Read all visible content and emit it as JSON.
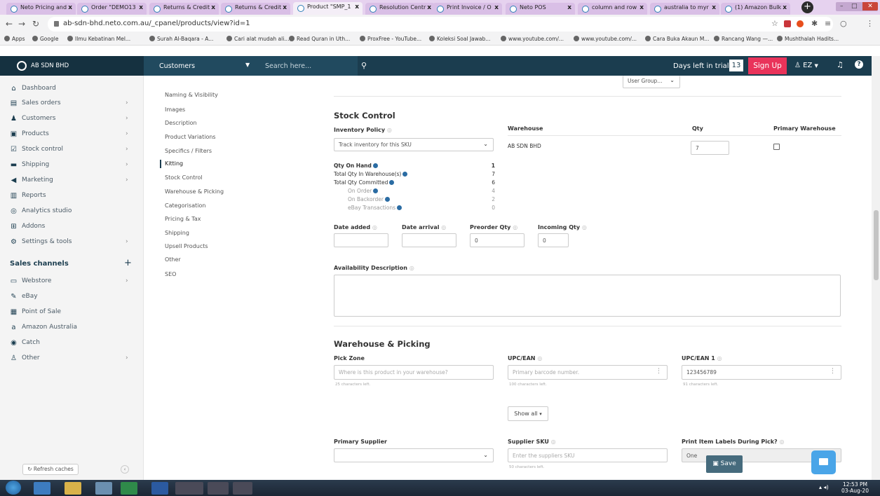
{
  "browser": {
    "tabs": [
      {
        "label": "Neto Pricing and"
      },
      {
        "label": "Order \"DEMO13"
      },
      {
        "label": "Returns & Credit"
      },
      {
        "label": "Returns & Credit"
      },
      {
        "label": "Product \"SMP_1"
      },
      {
        "label": "Resolution Centr"
      },
      {
        "label": "Print Invoice / O"
      },
      {
        "label": "Neto POS"
      },
      {
        "label": "column and row"
      },
      {
        "label": "australia to myr"
      },
      {
        "label": "(1) Amazon Bulk"
      }
    ],
    "active_tab_index": 4,
    "url": "ab-sdn-bhd.neto.com.au/_cpanel/products/view?id=1",
    "bookmarks": [
      "Apps",
      "Google",
      "Ilmu Kebatinan Mel...",
      "Surah Al-Baqara - A...",
      "Cari alat mudah ali...",
      "Read Quran in Uth...",
      "ProxFree - YouTube...",
      "Koleksi Soal Jawab...",
      "www.youtube.com/...",
      "www.youtube.com/...",
      "Cara Buka Akaun M...",
      "Rancang Wang —...",
      "Mushthalah Hadits..."
    ]
  },
  "header": {
    "company": "AB SDN BHD",
    "context_select": "Customers",
    "search_placeholder": "Search here...",
    "trial_label": "Days left in trial",
    "trial_days": "13",
    "signup": "Sign Up",
    "user": "EZ"
  },
  "sidebar": {
    "items": [
      {
        "label": "Dashboard",
        "icon": "home-icon",
        "glyph": "⌂"
      },
      {
        "label": "Sales orders",
        "icon": "document-icon",
        "glyph": "▤"
      },
      {
        "label": "Customers",
        "icon": "users-icon",
        "glyph": "♟"
      },
      {
        "label": "Products",
        "icon": "box-icon",
        "glyph": "▣"
      },
      {
        "label": "Stock control",
        "icon": "check-icon",
        "glyph": "☑"
      },
      {
        "label": "Shipping",
        "icon": "truck-icon",
        "glyph": "▬"
      },
      {
        "label": "Marketing",
        "icon": "megaphone-icon",
        "glyph": "◀"
      },
      {
        "label": "Reports",
        "icon": "bar-chart-icon",
        "glyph": "▥"
      },
      {
        "label": "Analytics studio",
        "icon": "analytics-icon",
        "glyph": "◎"
      },
      {
        "label": "Addons",
        "icon": "plus-box-icon",
        "glyph": "⊞"
      },
      {
        "label": "Settings & tools",
        "icon": "gear-icon",
        "glyph": "⚙"
      }
    ],
    "channels_heading": "Sales channels",
    "channels": [
      {
        "label": "Webstore",
        "icon": "webstore-icon",
        "glyph": "▭"
      },
      {
        "label": "eBay",
        "icon": "ebay-icon",
        "glyph": "✎"
      },
      {
        "label": "Point of Sale",
        "icon": "pos-icon",
        "glyph": "▦"
      },
      {
        "label": "Amazon Australia",
        "icon": "amazon-icon",
        "glyph": "a"
      },
      {
        "label": "Catch",
        "icon": "catch-icon",
        "glyph": "◉"
      },
      {
        "label": "Other",
        "icon": "other-icon",
        "glyph": "♙"
      }
    ],
    "refresh": "Refresh caches"
  },
  "section_nav": [
    "Naming & Visibility",
    "Images",
    "Description",
    "Product Variations",
    "Specifics / Filters",
    "Kitting",
    "Stock Control",
    "Warehouse & Picking",
    "Categorisation",
    "Pricing & Tax",
    "Shipping",
    "Upsell Products",
    "Other",
    "SEO"
  ],
  "main": {
    "user_group_select": "User Group...",
    "stock_control": {
      "title": "Stock Control",
      "inventory_policy_label": "Inventory Policy",
      "inventory_policy_value": "Track inventory for this SKU",
      "warehouse_header": "Warehouse",
      "qty_header": "Qty",
      "primary_header": "Primary Warehouse",
      "warehouse_name": "AB SDN BHD",
      "warehouse_qty": "7",
      "stats": [
        {
          "label": "Qty On Hand",
          "value": "1"
        },
        {
          "label": "Total Qty In Warehouse(s)",
          "value": "7"
        },
        {
          "label": "Total Qty Committed",
          "value": "6"
        },
        {
          "label": "On Order",
          "value": "4"
        },
        {
          "label": "On Backorder",
          "value": "2"
        },
        {
          "label": "eBay Transactions",
          "value": "0"
        }
      ],
      "date_added_label": "Date added",
      "date_arrival_label": "Date arrival",
      "preorder_label": "Preorder Qty",
      "preorder_value": "0",
      "incoming_label": "Incoming Qty",
      "incoming_value": "0",
      "availability_label": "Availability Description"
    },
    "warehouse_picking": {
      "title": "Warehouse & Picking",
      "pick_zone_label": "Pick Zone",
      "pick_zone_placeholder": "Where is this product in your warehouse?",
      "pick_zone_hint": "25 characters left.",
      "upc_label": "UPC/EAN",
      "upc_placeholder": "Primary barcode number.",
      "upc_hint": "100 characters left.",
      "upc1_label": "UPC/EAN 1",
      "upc1_value": "123456789",
      "upc1_hint": "91 characters left.",
      "show_all": "Show all",
      "supplier_label": "Primary Supplier",
      "supplier_sku_label": "Supplier SKU",
      "supplier_sku_placeholder": "Enter the suppliers SKU",
      "supplier_sku_hint": "50 characters left.",
      "print_labels_label": "Print Item Labels During Pick?",
      "print_labels_value": "One"
    },
    "save": "Save"
  },
  "taskbar": {
    "time": "12:53 PM",
    "date": "03-Aug-20"
  }
}
